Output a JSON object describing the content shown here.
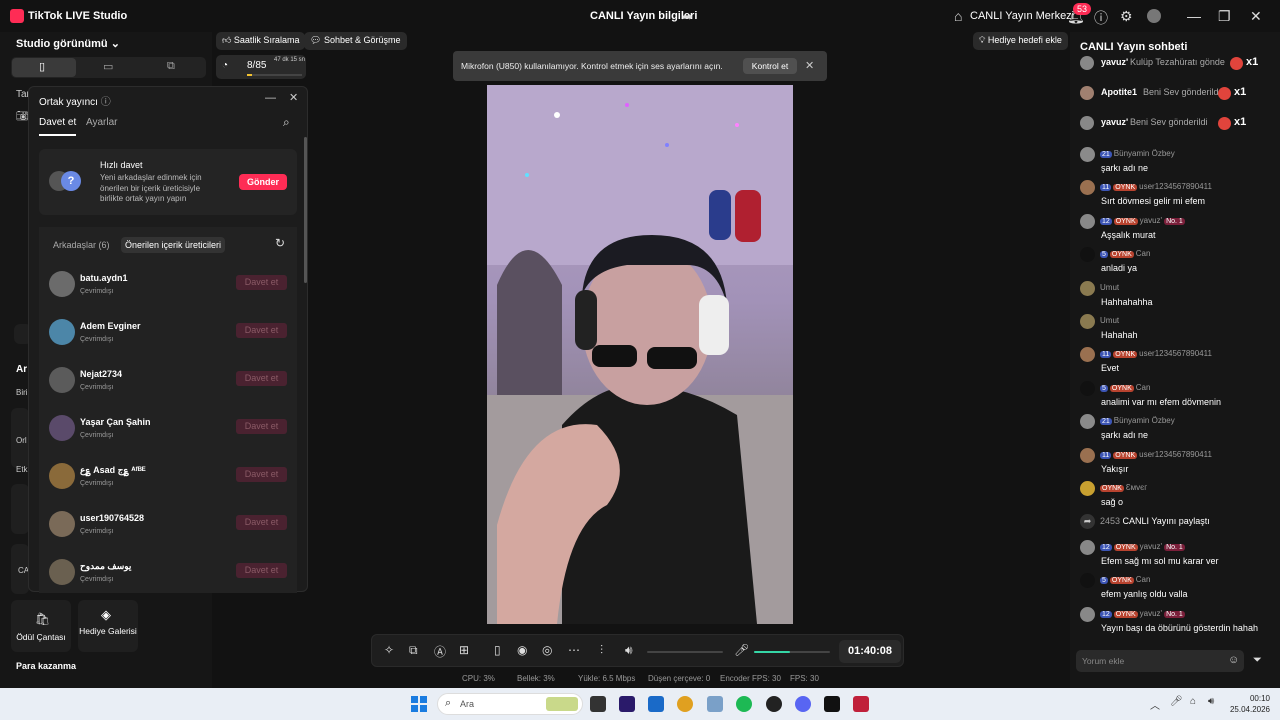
{
  "titlebar": {
    "app_name": "TikTok LIVE Studio",
    "center_title": "CANLI Yayın bilgileri",
    "live_center": "CANLI Yayın Merkezi",
    "notification_count": "53"
  },
  "left_panel": {
    "studio_view": "Studio görünümü",
    "truncated_labels": [
      "Tar",
      "Ar",
      "Biri",
      "Orl",
      "Etk",
      "CA"
    ],
    "bottom_items": [
      {
        "label": "Ödül Çantası"
      },
      {
        "label": "Hediye Galerisi"
      }
    ],
    "money_label": "Para kazanma"
  },
  "tools": {
    "ranking": "Saatlik Sıralama",
    "chat_meet": "Sohbet & Görüşme",
    "goal_value": "8/85",
    "goal_time": "47 dk 15 sn",
    "gift_goal": "Hediye hedefi ekle"
  },
  "cohost": {
    "title": "Ortak yayıncı",
    "tab_invite": "Davet et",
    "tab_settings": "Ayarlar",
    "quick_title": "Hızlı davet",
    "quick_desc": "Yeni arkadaşlar edinmek için önerilen bir içerik üreticisiyle birlikte ortak yayın yapın",
    "send_btn": "Gönder",
    "friends_tab": "Arkadaşlar (6)",
    "suggested_tab": "Önerilen içerik üreticileri",
    "users": [
      {
        "name": "batu.aydn1",
        "status": "Çevrimdışı",
        "btn": "Davet et",
        "color": "#6b6b6b"
      },
      {
        "name": "Adem Evginer",
        "status": "Çevrimdışı",
        "btn": "Davet et",
        "color": "#4c86a8"
      },
      {
        "name": "Nejat2734",
        "status": "Çevrimdışı",
        "btn": "Davet et",
        "color": "#5b5b5b"
      },
      {
        "name": "Yaşar Çan Şahin",
        "status": "Çevrimdışı",
        "btn": "Davet et",
        "color": "#5a4a6a"
      },
      {
        "name": "ع؏ Asad ج؏ ᴬᶠᴮᴱ",
        "status": "Çevrimdışı",
        "btn": "Davet et",
        "color": "#8a6a3a"
      },
      {
        "name": "user190764528",
        "status": "Çevrimdışı",
        "btn": "Davet et",
        "color": "#7a6a58"
      },
      {
        "name": "يوسف ممدوح",
        "status": "Çevrimdışı",
        "btn": "Davet et",
        "color": "#6a6050"
      }
    ]
  },
  "notice": {
    "text": "Mikrofon (U850) kullanılamıyor. Kontrol etmek için ses ayarlarını açın.",
    "button": "Kontrol et"
  },
  "controls": {
    "timer": "01:40:08"
  },
  "stats": {
    "cpu": "CPU:  3%",
    "memory": "Bellek:  3%",
    "upload": "Yükle:  6.5 Mbps",
    "dropped": "Düşen çerçeve:  0",
    "encoder_fps": "Encoder FPS:  30",
    "fps": "FPS:  30"
  },
  "chat": {
    "title": "CANLI Yayın sohbeti",
    "gifts": [
      {
        "user": "yavuz'",
        "text": "Kulüp Tezahüratı gönde",
        "mult": "x1",
        "avatar": "#888"
      },
      {
        "user": "Apotite1",
        "text": "Beni Sev gönderildi",
        "mult": "x1",
        "avatar": "#a08070"
      },
      {
        "user": "yavuz'",
        "text": "Beni Sev gönderildi",
        "mult": "x1",
        "avatar": "#888"
      }
    ],
    "messages": [
      {
        "level": "21",
        "fan": "",
        "user": "Bünyamin Özbey",
        "no1": "",
        "text": "şarkı adı ne",
        "avatar": "#8a8a8a"
      },
      {
        "level": "11",
        "fan": "OYNK",
        "user": "user1234567890411",
        "no1": "",
        "text": "Sırt dövmesi gelir mi efem",
        "avatar": "#9a7050"
      },
      {
        "level": "12",
        "fan": "OYNK",
        "user": "yavuz'",
        "no1": "No. 1",
        "text": "Aşşalık murat",
        "avatar": "#888"
      },
      {
        "level": "5",
        "fan": "OYNK",
        "user": "Can",
        "no1": "",
        "text": "anladi ya",
        "avatar": "#111"
      },
      {
        "level": "",
        "fan": "",
        "user": "Umut",
        "no1": "",
        "text": "Hahhahahha",
        "avatar": "#8a7a50"
      },
      {
        "level": "",
        "fan": "",
        "user": "Umut",
        "no1": "",
        "text": "Hahahah",
        "avatar": "#8a7a50"
      },
      {
        "level": "11",
        "fan": "OYNK",
        "user": "user1234567890411",
        "no1": "",
        "text": "Evet",
        "avatar": "#9a7050"
      },
      {
        "level": "5",
        "fan": "OYNK",
        "user": "Can",
        "no1": "",
        "text": "analimi var mı efem dövmenin",
        "avatar": "#111"
      },
      {
        "level": "21",
        "fan": "",
        "user": "Bünyamin Özbey",
        "no1": "",
        "text": "şarkı adı ne",
        "avatar": "#8a8a8a"
      },
      {
        "level": "11",
        "fan": "OYNK",
        "user": "user1234567890411",
        "no1": "",
        "text": "Yakışır",
        "avatar": "#9a7050"
      },
      {
        "level": "",
        "fan": "OYNK",
        "user": "Ɛмvєг",
        "no1": "",
        "text": "sağ o",
        "avatar": "#c8a030"
      }
    ],
    "share_count": "2453",
    "share_text": "CANLI Yayını paylaştı",
    "messages2": [
      {
        "level": "12",
        "fan": "OYNK",
        "user": "yavuz'",
        "no1": "No. 1",
        "text": "Efem sağ mı sol mu karar ver",
        "avatar": "#888"
      },
      {
        "level": "5",
        "fan": "OYNK",
        "user": "Can",
        "no1": "",
        "text": "efem yanlış oldu valla",
        "avatar": "#111"
      },
      {
        "level": "12",
        "fan": "OYNK",
        "user": "yavuz'",
        "no1": "No. 1",
        "text": "Yayın başı da öbürünü gösterdin hahah",
        "avatar": "#888"
      }
    ],
    "input_placeholder": "Yorum ekle"
  },
  "taskbar": {
    "search": "Ara",
    "time": "00:10",
    "date": "25.04.2026"
  }
}
